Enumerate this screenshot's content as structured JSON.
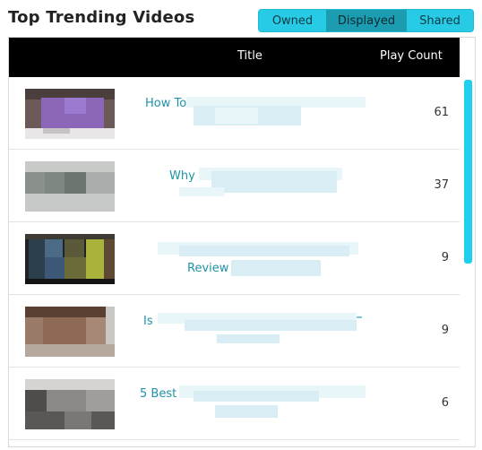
{
  "header": {
    "title": "Top Trending Videos",
    "segments": [
      "Owned",
      "Displayed",
      "Shared"
    ],
    "selected": "Displayed"
  },
  "table": {
    "columns": {
      "title": "Title",
      "play_count": "Play Count"
    },
    "rows": [
      {
        "title": "How To",
        "play_count": "61"
      },
      {
        "title": "Why",
        "play_count": "37"
      },
      {
        "title": "Review",
        "play_count": "9"
      },
      {
        "title": "Is",
        "play_count": "9"
      },
      {
        "title": "5 Best",
        "play_count": "6"
      }
    ]
  },
  "colors": {
    "accent": "#22c5e0",
    "selected_segment": "#1b9cb1",
    "header_bg": "#000000",
    "link": "#1f93a8"
  }
}
